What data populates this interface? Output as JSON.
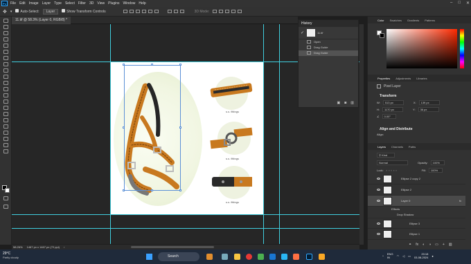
{
  "app": {
    "logo": "Ps"
  },
  "menu": [
    "File",
    "Edit",
    "Image",
    "Layer",
    "Type",
    "Select",
    "Filter",
    "3D",
    "View",
    "Plugins",
    "Window",
    "Help"
  ],
  "options": {
    "auto_select": "Auto-Select:",
    "auto_select_value": "Layer",
    "show_transform": "Show Transform Controls",
    "mode_3d": "3D Mode:"
  },
  "document": {
    "tab_title": "11.tif @ 58.3% (Layer 0, RGB/8) *",
    "zoom": "58.26%",
    "dimensions": "1467 px x 1467 px (72 ppi)"
  },
  "canvas": {
    "captions": [
      "s.s. fittings",
      "s.s. fittings",
      "s.s. fittings"
    ]
  },
  "history": {
    "title": "History",
    "snapshot": "11.tif",
    "items": [
      "Open",
      "Drag Guide",
      "Drag Guide"
    ]
  },
  "color_panel": {
    "tabs": [
      "Color",
      "Swatches",
      "Gradients",
      "Patterns"
    ]
  },
  "properties": {
    "tabs": [
      "Properties",
      "Adjustments",
      "Libraries"
    ],
    "kind": "Pixel Layer",
    "transform_title": "Transform",
    "w": "513 px",
    "x": "139 px",
    "h": "1170 px",
    "y": "36 px",
    "angle": "0.00°",
    "align_title": "Align and Distribute",
    "align_label": "Align:"
  },
  "layers": {
    "tabs": [
      "Layers",
      "Channels",
      "Paths"
    ],
    "filter": "Kind",
    "blend": "Normal",
    "opacity_label": "Opacity:",
    "opacity": "100%",
    "lock_label": "Lock:",
    "fill_label": "Fill:",
    "fill": "100%",
    "items": [
      "Ellipse 2 copy 2",
      "Ellipse 2",
      "Layer 0",
      "Ellipse 3",
      "Ellipse 1"
    ],
    "effects_label": "Effects",
    "drop_shadow": "Drop Shadow",
    "fx": "fx"
  },
  "taskbar": {
    "weather_temp": "29°C",
    "weather_desc": "Partly cloudy",
    "search": "Search",
    "lang": "ENG",
    "region": "IN",
    "time": "20:18",
    "date": "03-08-2024"
  }
}
